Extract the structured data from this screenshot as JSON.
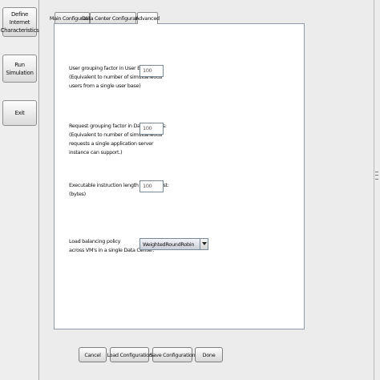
{
  "sidebar": {
    "define_internet_label": "Define Internet Characteristics",
    "run_simulation_label": "Run Simulation",
    "exit_label": "Exit"
  },
  "tabs": [
    {
      "label": "Main Configuration"
    },
    {
      "label": "Data Center Configuration"
    },
    {
      "label": "Advanced"
    }
  ],
  "active_tab": "Advanced",
  "advanced": {
    "user_grouping": {
      "label_lines": [
        "User grouping factor in User Bases:",
        "(Equivalent to number of simultaneous",
        "users from a single user base)"
      ],
      "value": "100"
    },
    "request_grouping": {
      "label_lines": [
        "Request grouping factor in Data Centers:",
        "(Equivalent to number of simultaneous",
        "requests a single application server",
        "instance can support.)"
      ],
      "value": "100"
    },
    "instruction_length": {
      "label_lines": [
        "Executable instruction length per request:",
        "(bytes)"
      ],
      "value": "100"
    },
    "load_balancing": {
      "label_lines": [
        "Load balancing policy",
        "across VM's in a single Data Center:"
      ],
      "value": "WeightedRoundRobin"
    }
  },
  "buttons": {
    "cancel": "Cancel",
    "load": "Load Configuration",
    "save": "Save Configuration",
    "done": "Done"
  }
}
